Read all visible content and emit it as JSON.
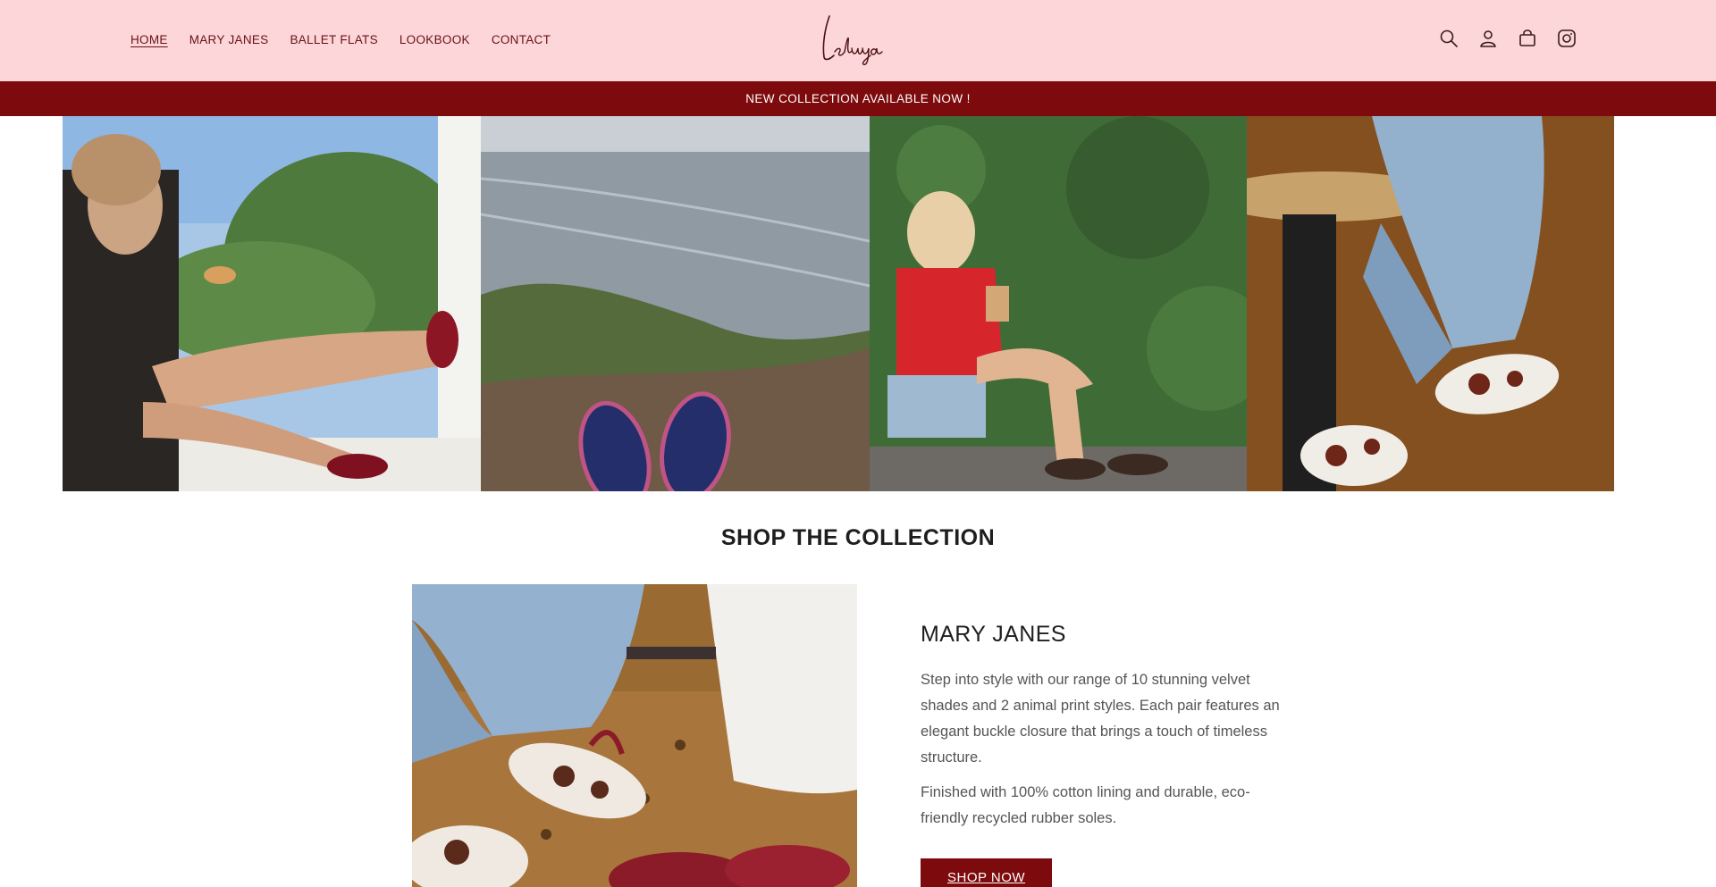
{
  "nav": {
    "items": [
      {
        "label": "HOME",
        "active": true
      },
      {
        "label": "MARY JANES"
      },
      {
        "label": "BALLET FLATS"
      },
      {
        "label": "LOOKBOOK"
      },
      {
        "label": "CONTACT"
      }
    ]
  },
  "brand": {
    "logo_text": "Leluya"
  },
  "header_icons": [
    "search-icon",
    "account-icon",
    "cart-icon",
    "instagram-icon"
  ],
  "announcement": {
    "text": "NEW COLLECTION AVAILABLE NOW !"
  },
  "colors": {
    "header_bg": "#fcd6d8",
    "accent": "#7d0a0c",
    "nav_text": "#6a1116"
  },
  "collection": {
    "title": "SHOP THE COLLECTION",
    "feature": {
      "heading": "MARY JANES",
      "paragraph_1": "Step into style with our range of 10 stunning velvet shades and 2 animal print styles. Each pair features an elegant buckle closure that brings a touch of timeless structure.",
      "paragraph_2": "Finished with 100% cotton lining and durable, eco-friendly recycled rubber soles.",
      "button": "SHOP NOW"
    }
  }
}
